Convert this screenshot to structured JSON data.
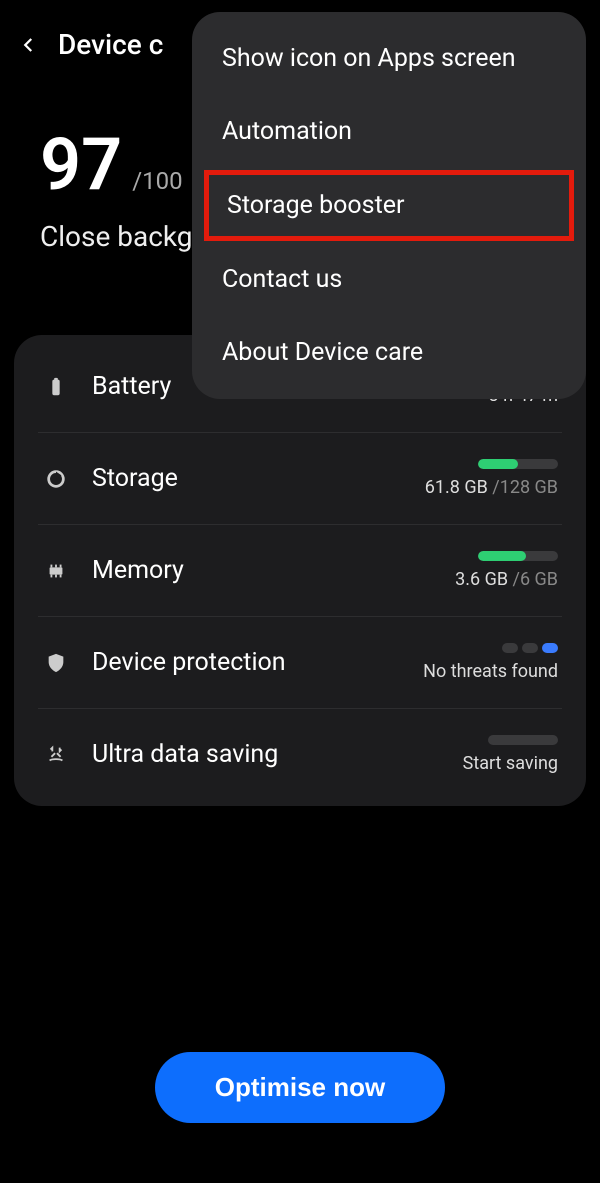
{
  "header": {
    "title": "Device c"
  },
  "score": {
    "value": "97",
    "max": "/100",
    "desc": "Close background apps and run checks"
  },
  "items": {
    "battery": {
      "label": "Battery",
      "value": "8 h 47 m",
      "fill_percent": 45
    },
    "storage": {
      "label": "Storage",
      "used": "61.8 GB",
      "total": "/128 GB",
      "fill_percent": 50
    },
    "memory": {
      "label": "Memory",
      "used": "3.6 GB",
      "total": "/6 GB",
      "fill_percent": 60
    },
    "protection": {
      "label": "Device protection",
      "value": "No threats found"
    },
    "ultra": {
      "label": "Ultra data saving",
      "value": "Start saving"
    }
  },
  "optimise": {
    "label": "Optimise now"
  },
  "menu": {
    "item0": "Show icon on Apps screen",
    "item1": "Automation",
    "item2": "Storage booster",
    "item3": "Contact us",
    "item4": "About Device care"
  }
}
